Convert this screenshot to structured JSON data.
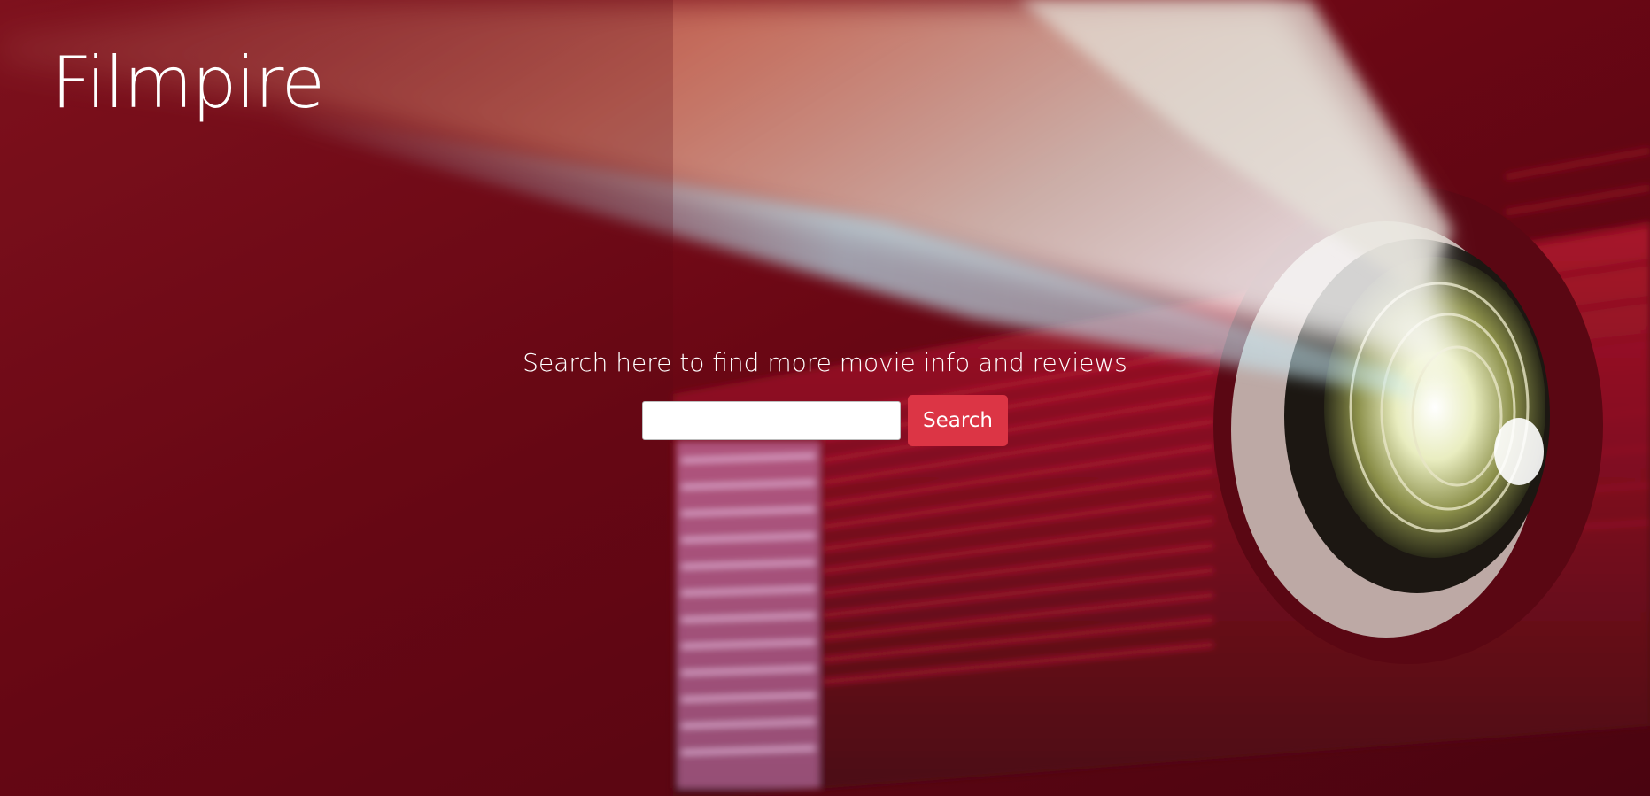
{
  "brand": {
    "title": "Filmpire"
  },
  "hero": {
    "tagline": "Search here to find more movie info and reviews",
    "background_icon": "projector-photo",
    "accent_color": "#dc3545"
  },
  "search": {
    "input_value": "",
    "placeholder": "",
    "button_label": "Search"
  }
}
